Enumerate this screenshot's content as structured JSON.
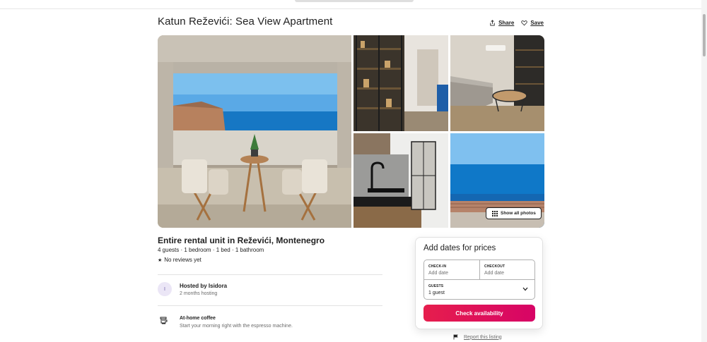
{
  "listing": {
    "title": "Katun Reževići: Sea View Apartment",
    "subtitle": "Entire rental unit in Reževići, Montenegro",
    "details": "4 guests · 1 bedroom · 1 bed · 1 bathroom",
    "reviews": "No reviews yet",
    "review_icon": "star-icon"
  },
  "actions": {
    "share_label": "Share",
    "save_label": "Save"
  },
  "gallery": {
    "show_all_label": "Show all photos",
    "photos": [
      "balcony-sea-view-photo",
      "shelving-hallway-photo",
      "living-room-photo",
      "kitchen-photo",
      "sea-horizon-photo"
    ]
  },
  "host": {
    "initial": "I",
    "name": "Hosted by Isidora",
    "tenure": "2 months hosting"
  },
  "amenity": {
    "icon": "coffee-machine-icon",
    "name": "At-home coffee",
    "description": "Start your morning right with the espresso machine."
  },
  "booking": {
    "title": "Add dates for prices",
    "checkin_label": "CHECK-IN",
    "checkin_value": "Add date",
    "checkout_label": "CHECKOUT",
    "checkout_value": "Add date",
    "guests_label": "GUESTS",
    "guests_value": "1 guest",
    "button_label": "Check availability"
  },
  "report": {
    "label": "Report this listing",
    "icon": "flag-icon"
  },
  "colors": {
    "accent": "#e61e4d",
    "accent_end": "#d70466",
    "text": "#222222",
    "muted": "#6a6a6a"
  }
}
